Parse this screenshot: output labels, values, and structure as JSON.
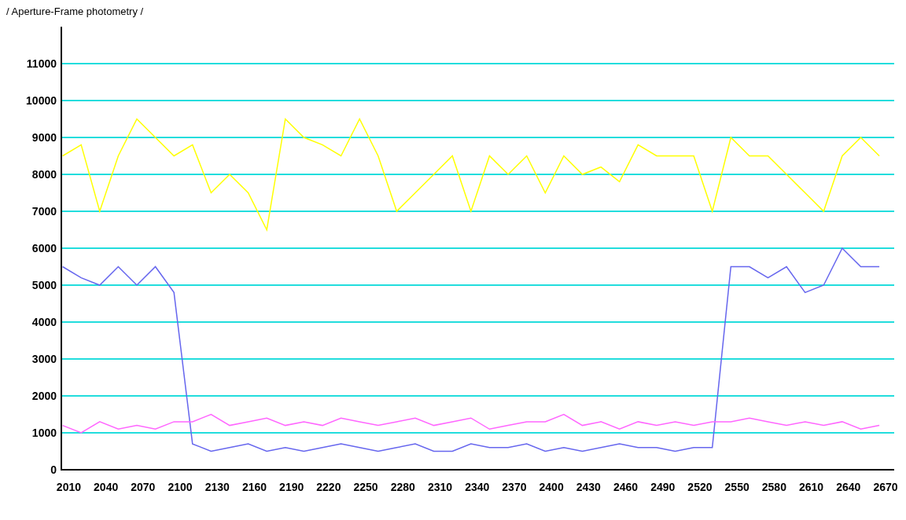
{
  "chart_data": {
    "type": "line",
    "title": "/ Aperture-Frame photometry /",
    "x": [
      2005,
      2020,
      2035,
      2050,
      2065,
      2080,
      2095,
      2110,
      2125,
      2140,
      2155,
      2170,
      2185,
      2200,
      2215,
      2230,
      2245,
      2260,
      2275,
      2290,
      2305,
      2320,
      2335,
      2350,
      2365,
      2380,
      2395,
      2410,
      2425,
      2440,
      2455,
      2470,
      2485,
      2500,
      2515,
      2530,
      2545,
      2560,
      2575,
      2590,
      2605,
      2620,
      2635,
      2650,
      2665
    ],
    "series": [
      {
        "color": "#ffff00",
        "values": [
          8500,
          8800,
          7000,
          8500,
          9500,
          9000,
          8500,
          8800,
          7500,
          8000,
          7500,
          6500,
          9500,
          9000,
          8800,
          8500,
          9500,
          8500,
          7000,
          7500,
          8000,
          8500,
          7000,
          8500,
          8000,
          8500,
          7500,
          8500,
          8000,
          8200,
          7800,
          8800,
          8500,
          8500,
          8500,
          7000,
          9000,
          8500,
          8500,
          8000,
          7500,
          7000,
          8500,
          9000,
          8500
        ]
      },
      {
        "color": "#6666ee",
        "values": [
          5500,
          5200,
          5000,
          5500,
          5000,
          5500,
          4800,
          700,
          500,
          600,
          700,
          500,
          600,
          500,
          600,
          700,
          600,
          500,
          600,
          700,
          500,
          500,
          700,
          600,
          600,
          700,
          500,
          600,
          500,
          600,
          700,
          600,
          600,
          500,
          600,
          600,
          5500,
          5500,
          5200,
          5500,
          4800,
          5000,
          6000,
          5500,
          5500
        ]
      },
      {
        "color": "#ff66ff",
        "values": [
          1200,
          1000,
          1300,
          1100,
          1200,
          1100,
          1300,
          1300,
          1500,
          1200,
          1300,
          1400,
          1200,
          1300,
          1200,
          1400,
          1300,
          1200,
          1300,
          1400,
          1200,
          1300,
          1400,
          1100,
          1200,
          1300,
          1300,
          1500,
          1200,
          1300,
          1100,
          1300,
          1200,
          1300,
          1200,
          1300,
          1300,
          1400,
          1300,
          1200,
          1300,
          1200,
          1300,
          1100,
          1200
        ]
      }
    ],
    "grid": "y",
    "xlim": [
      2004,
      2677
    ],
    "ylim": [
      0,
      12000
    ],
    "xticks": [
      2010,
      2040,
      2070,
      2100,
      2130,
      2160,
      2190,
      2220,
      2250,
      2280,
      2310,
      2340,
      2370,
      2400,
      2430,
      2460,
      2490,
      2520,
      2550,
      2580,
      2610,
      2640,
      2670
    ],
    "yticks": [
      0,
      1000,
      2000,
      3000,
      4000,
      5000,
      6000,
      7000,
      8000,
      9000,
      10000,
      11000
    ]
  }
}
